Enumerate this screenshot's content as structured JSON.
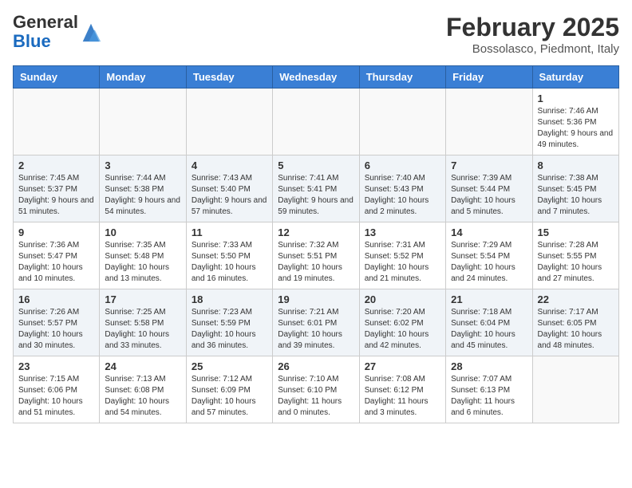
{
  "header": {
    "logo_general": "General",
    "logo_blue": "Blue",
    "month_title": "February 2025",
    "location": "Bossolasco, Piedmont, Italy"
  },
  "weekdays": [
    "Sunday",
    "Monday",
    "Tuesday",
    "Wednesday",
    "Thursday",
    "Friday",
    "Saturday"
  ],
  "weeks": [
    [
      {
        "day": "",
        "info": ""
      },
      {
        "day": "",
        "info": ""
      },
      {
        "day": "",
        "info": ""
      },
      {
        "day": "",
        "info": ""
      },
      {
        "day": "",
        "info": ""
      },
      {
        "day": "",
        "info": ""
      },
      {
        "day": "1",
        "info": "Sunrise: 7:46 AM\nSunset: 5:36 PM\nDaylight: 9 hours and 49 minutes."
      }
    ],
    [
      {
        "day": "2",
        "info": "Sunrise: 7:45 AM\nSunset: 5:37 PM\nDaylight: 9 hours and 51 minutes."
      },
      {
        "day": "3",
        "info": "Sunrise: 7:44 AM\nSunset: 5:38 PM\nDaylight: 9 hours and 54 minutes."
      },
      {
        "day": "4",
        "info": "Sunrise: 7:43 AM\nSunset: 5:40 PM\nDaylight: 9 hours and 57 minutes."
      },
      {
        "day": "5",
        "info": "Sunrise: 7:41 AM\nSunset: 5:41 PM\nDaylight: 9 hours and 59 minutes."
      },
      {
        "day": "6",
        "info": "Sunrise: 7:40 AM\nSunset: 5:43 PM\nDaylight: 10 hours and 2 minutes."
      },
      {
        "day": "7",
        "info": "Sunrise: 7:39 AM\nSunset: 5:44 PM\nDaylight: 10 hours and 5 minutes."
      },
      {
        "day": "8",
        "info": "Sunrise: 7:38 AM\nSunset: 5:45 PM\nDaylight: 10 hours and 7 minutes."
      }
    ],
    [
      {
        "day": "9",
        "info": "Sunrise: 7:36 AM\nSunset: 5:47 PM\nDaylight: 10 hours and 10 minutes."
      },
      {
        "day": "10",
        "info": "Sunrise: 7:35 AM\nSunset: 5:48 PM\nDaylight: 10 hours and 13 minutes."
      },
      {
        "day": "11",
        "info": "Sunrise: 7:33 AM\nSunset: 5:50 PM\nDaylight: 10 hours and 16 minutes."
      },
      {
        "day": "12",
        "info": "Sunrise: 7:32 AM\nSunset: 5:51 PM\nDaylight: 10 hours and 19 minutes."
      },
      {
        "day": "13",
        "info": "Sunrise: 7:31 AM\nSunset: 5:52 PM\nDaylight: 10 hours and 21 minutes."
      },
      {
        "day": "14",
        "info": "Sunrise: 7:29 AM\nSunset: 5:54 PM\nDaylight: 10 hours and 24 minutes."
      },
      {
        "day": "15",
        "info": "Sunrise: 7:28 AM\nSunset: 5:55 PM\nDaylight: 10 hours and 27 minutes."
      }
    ],
    [
      {
        "day": "16",
        "info": "Sunrise: 7:26 AM\nSunset: 5:57 PM\nDaylight: 10 hours and 30 minutes."
      },
      {
        "day": "17",
        "info": "Sunrise: 7:25 AM\nSunset: 5:58 PM\nDaylight: 10 hours and 33 minutes."
      },
      {
        "day": "18",
        "info": "Sunrise: 7:23 AM\nSunset: 5:59 PM\nDaylight: 10 hours and 36 minutes."
      },
      {
        "day": "19",
        "info": "Sunrise: 7:21 AM\nSunset: 6:01 PM\nDaylight: 10 hours and 39 minutes."
      },
      {
        "day": "20",
        "info": "Sunrise: 7:20 AM\nSunset: 6:02 PM\nDaylight: 10 hours and 42 minutes."
      },
      {
        "day": "21",
        "info": "Sunrise: 7:18 AM\nSunset: 6:04 PM\nDaylight: 10 hours and 45 minutes."
      },
      {
        "day": "22",
        "info": "Sunrise: 7:17 AM\nSunset: 6:05 PM\nDaylight: 10 hours and 48 minutes."
      }
    ],
    [
      {
        "day": "23",
        "info": "Sunrise: 7:15 AM\nSunset: 6:06 PM\nDaylight: 10 hours and 51 minutes."
      },
      {
        "day": "24",
        "info": "Sunrise: 7:13 AM\nSunset: 6:08 PM\nDaylight: 10 hours and 54 minutes."
      },
      {
        "day": "25",
        "info": "Sunrise: 7:12 AM\nSunset: 6:09 PM\nDaylight: 10 hours and 57 minutes."
      },
      {
        "day": "26",
        "info": "Sunrise: 7:10 AM\nSunset: 6:10 PM\nDaylight: 11 hours and 0 minutes."
      },
      {
        "day": "27",
        "info": "Sunrise: 7:08 AM\nSunset: 6:12 PM\nDaylight: 11 hours and 3 minutes."
      },
      {
        "day": "28",
        "info": "Sunrise: 7:07 AM\nSunset: 6:13 PM\nDaylight: 11 hours and 6 minutes."
      },
      {
        "day": "",
        "info": ""
      }
    ]
  ]
}
